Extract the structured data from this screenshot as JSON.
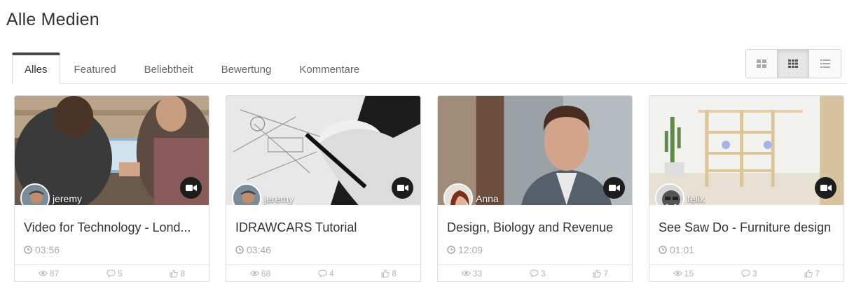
{
  "page": {
    "title": "Alle Medien"
  },
  "tabs": [
    {
      "label": "Alles",
      "active": true
    },
    {
      "label": "Featured",
      "active": false
    },
    {
      "label": "Beliebtheit",
      "active": false
    },
    {
      "label": "Bewertung",
      "active": false
    },
    {
      "label": "Kommentare",
      "active": false
    }
  ],
  "view_toggle": {
    "options": [
      "large-grid-icon",
      "medium-grid-icon",
      "list-icon"
    ],
    "active": "medium-grid-icon"
  },
  "cards": [
    {
      "author": "jeremy",
      "title": "Video for Technology - Lond...",
      "duration": "03:56",
      "views": "87",
      "comments": "5",
      "likes": "8"
    },
    {
      "author": "jeremy",
      "title": "IDRAWCARS Tutorial",
      "duration": "03:46",
      "views": "68",
      "comments": "4",
      "likes": "8"
    },
    {
      "author": "Anna",
      "title": "Design, Biology and Revenue",
      "duration": "12:09",
      "views": "33",
      "comments": "3",
      "likes": "7"
    },
    {
      "author": "felix",
      "title": "See Saw Do - Furniture design",
      "duration": "01:01",
      "views": "15",
      "comments": "3",
      "likes": "7"
    }
  ],
  "colors": {
    "tab_active_border": "#4a4a4a",
    "muted_text": "#aaaaaa",
    "badge_bg": "#1d1d1d"
  }
}
